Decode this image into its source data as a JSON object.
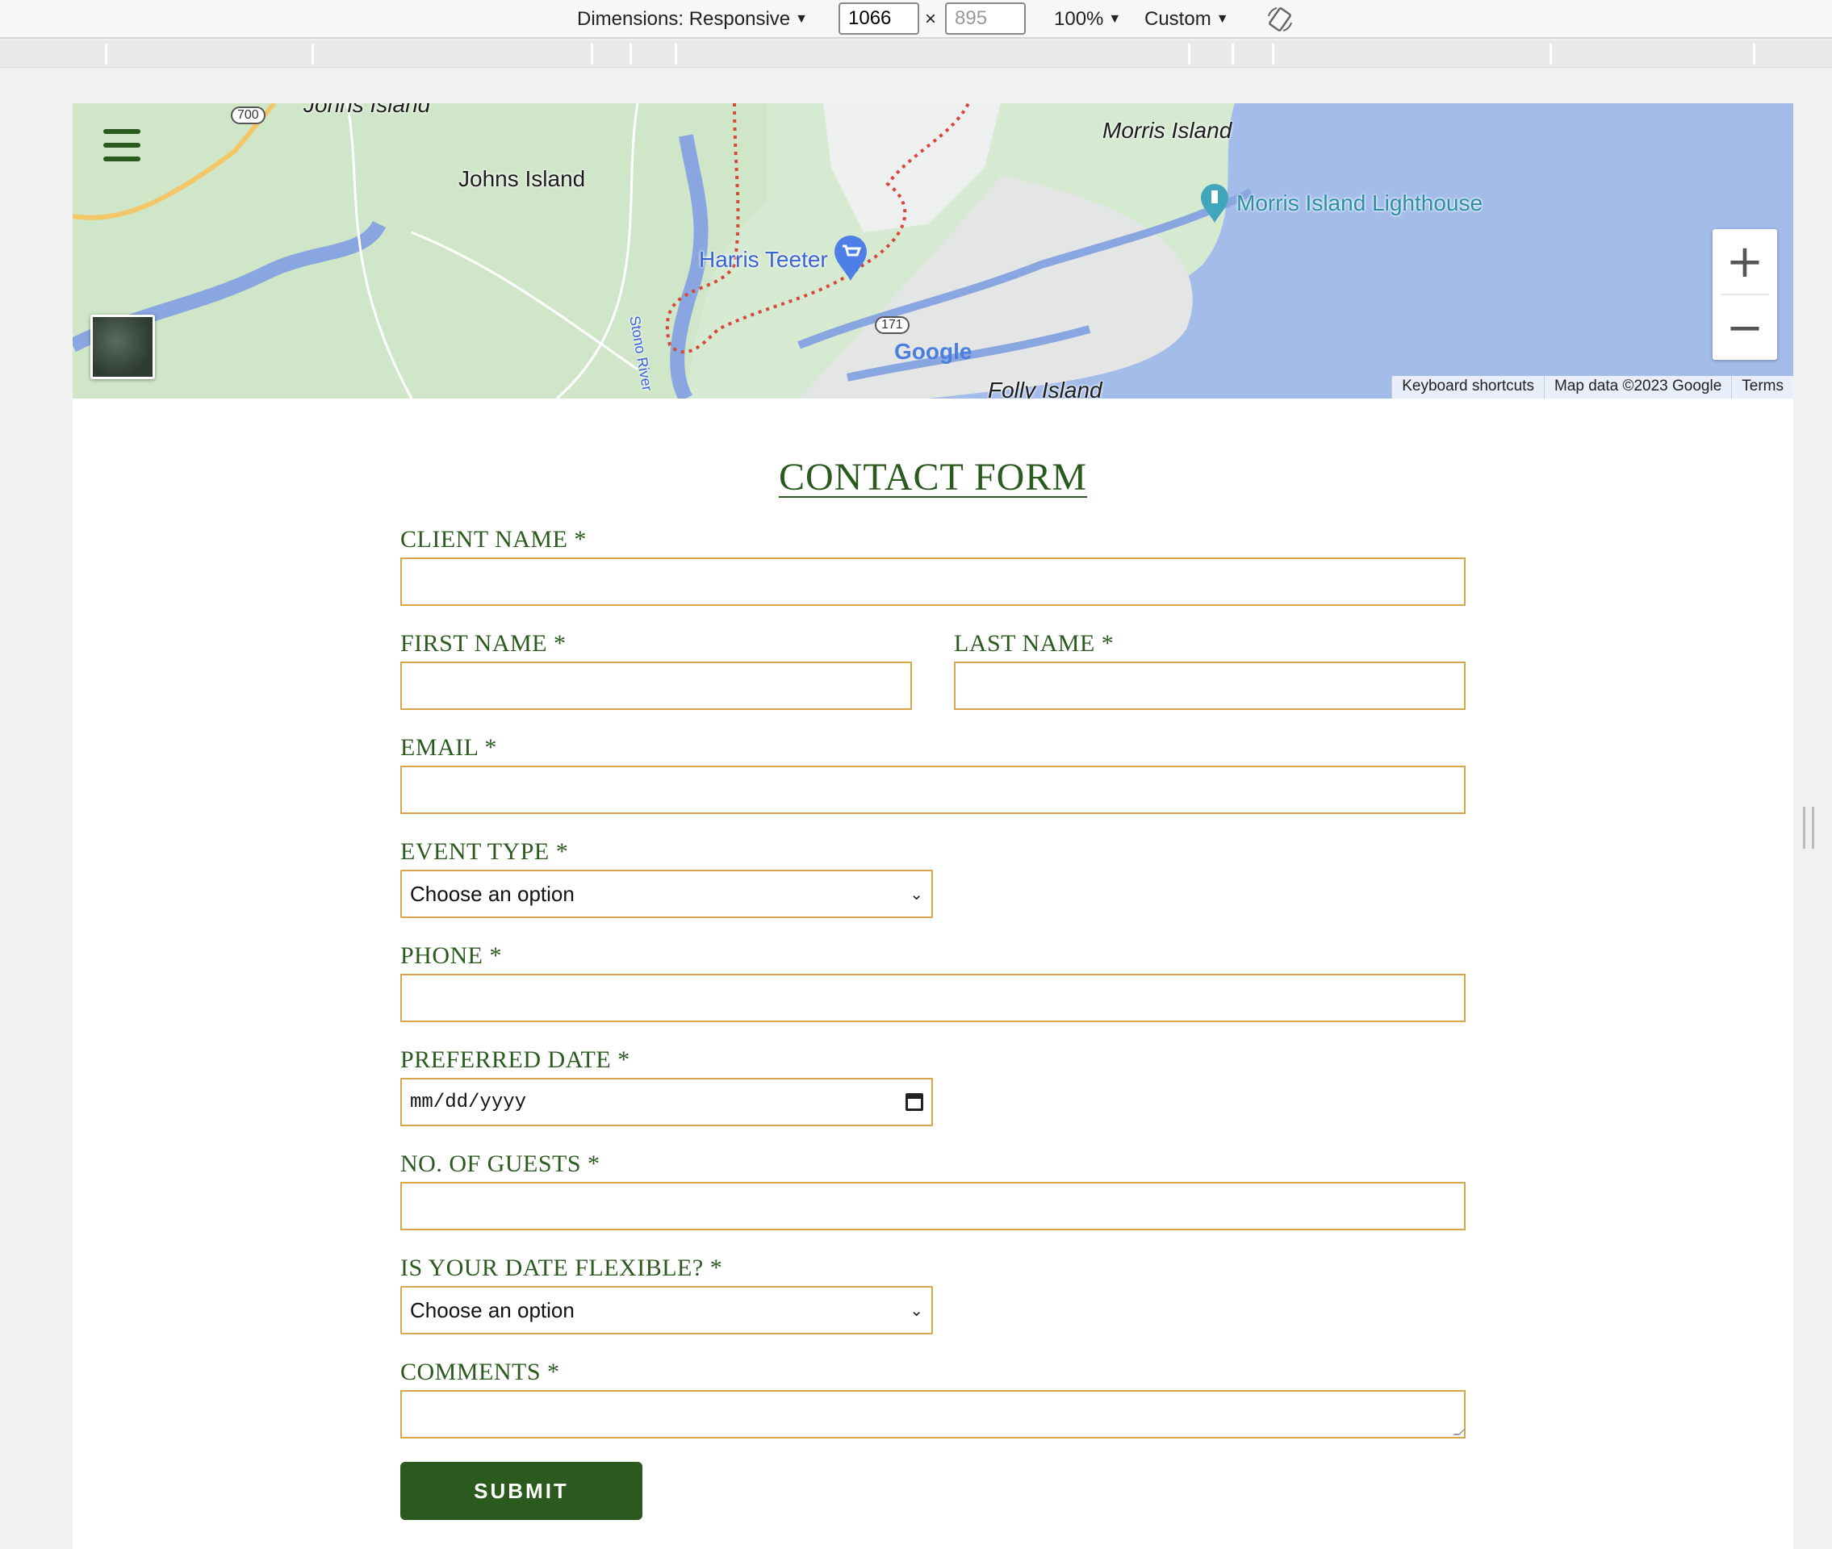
{
  "devtools": {
    "dimensions_label": "Dimensions: Responsive",
    "width_value": "1066",
    "height_value": "895",
    "times_sign": "×",
    "zoom": "100%",
    "throttle": "Custom",
    "caret": "▼",
    "rotate_icon": "rotate-icon"
  },
  "map": {
    "labels": {
      "johns_island_top": "Johns Island",
      "johns_island": "Johns Island",
      "morris_island": "Morris Island",
      "morris_lighthouse": "Morris Island Lighthouse",
      "harris_teeter": "Harris Teeter",
      "stono_river": "Stono River",
      "folly_island": "Folly Island",
      "route_700": "700",
      "route_171": "171"
    },
    "google_logo": "Google",
    "zoom_in": "+",
    "zoom_out": "−",
    "footer": {
      "shortcuts": "Keyboard shortcuts",
      "map_data": "Map data ©2023 Google",
      "terms": "Terms"
    },
    "colors": {
      "water": "#a3bce9",
      "land": "#d5ead1",
      "route": "#d8473b"
    }
  },
  "form": {
    "title": "CONTACT FORM",
    "client_name_label": "CLIENT NAME *",
    "first_name_label": "FIRST NAME *",
    "last_name_label": "LAST NAME *",
    "email_label": "EMAIL *",
    "event_type_label": "EVENT TYPE *",
    "event_type_value": "Choose an option",
    "phone_label": "PHONE *",
    "preferred_date_label": "PREFERRED DATE *",
    "preferred_date_placeholder": "mm/dd/yyyy",
    "guests_label": "NO. OF GUESTS *",
    "flexible_label": "IS YOUR DATE FLEXIBLE? *",
    "flexible_value": "Choose an option",
    "comments_label": "COMMENTS *",
    "submit_label": "SUBMIT",
    "chevron": "⌄"
  },
  "colors": {
    "brand_green": "#2b5a1f",
    "field_border": "#d6a74a"
  }
}
